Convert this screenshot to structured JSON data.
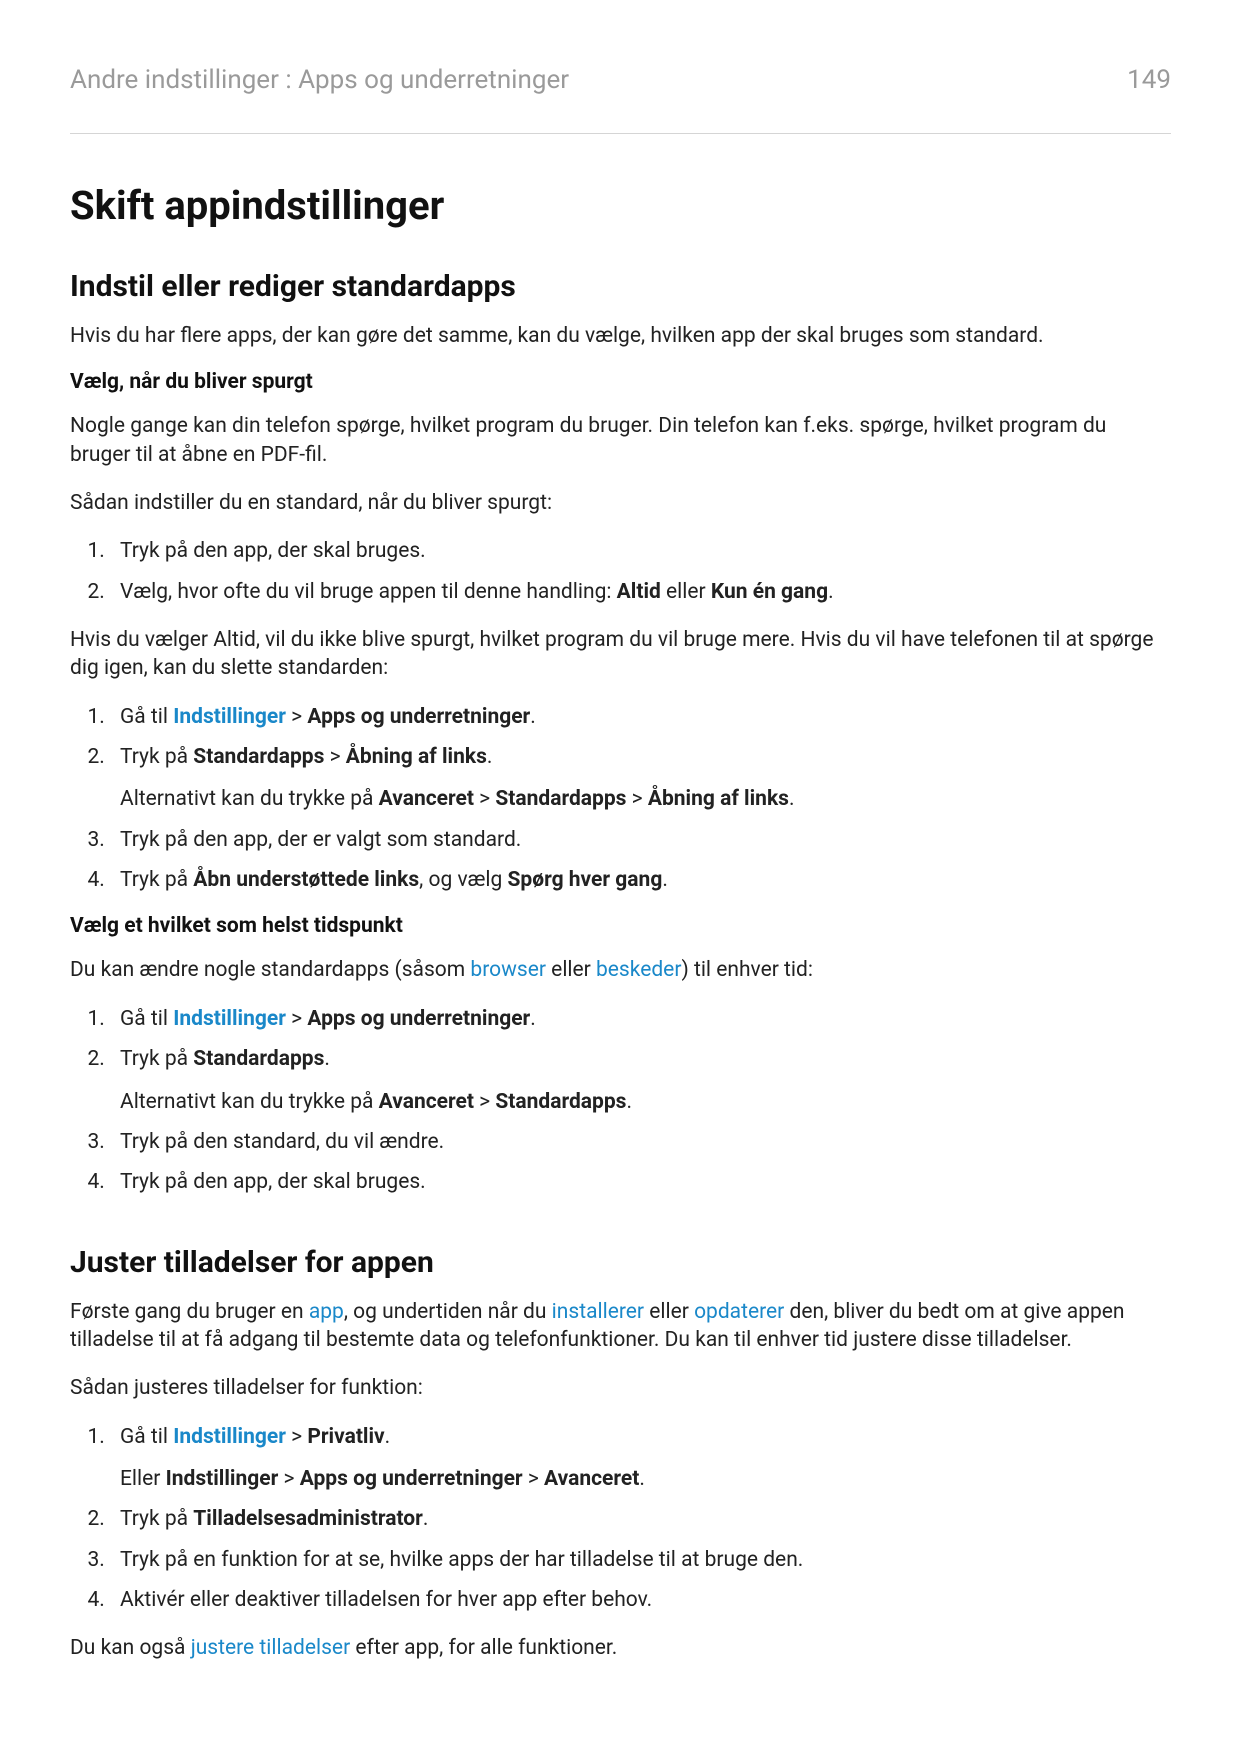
{
  "header": {
    "breadcrumb": "Andre indstillinger : Apps og underretninger",
    "page": "149"
  },
  "title": "Skift appindstillinger",
  "section1": {
    "heading": "Indstil eller rediger standardapps",
    "intro": "Hvis du har flere apps, der kan gøre det samme, kan du vælge, hvilken app der skal bruges som standard.",
    "sub1_heading": "Vælg, når du bliver spurgt",
    "sub1_p1": "Nogle gange kan din telefon spørge, hvilket program du bruger. Din telefon kan f.eks. spørge, hvilket program du bruger til at åbne en PDF-fil.",
    "sub1_p2": "Sådan indstiller du en standard, når du bliver spurgt:",
    "sub1_list": {
      "i1": "Tryk på den app, der skal bruges.",
      "i2_pre": "Vælg, hvor ofte du vil bruge appen til denne handling: ",
      "i2_b1": "Altid",
      "i2_mid": " eller ",
      "i2_b2": "Kun én gang",
      "i2_end": "."
    },
    "sub1_p3": "Hvis du vælger Altid, vil du ikke blive spurgt, hvilket program du vil bruge mere. Hvis du vil have telefonen til at spørge dig igen, kan du slette standarden:",
    "sub1_list2": {
      "i1_pre": "Gå til ",
      "i1_link": "Indstillinger",
      "i1_gt": " > ",
      "i1_b": "Apps og underretninger",
      "i1_end": ".",
      "i2_pre": "Tryk på ",
      "i2_b1": "Standardapps",
      "i2_gt": " > ",
      "i2_b2": "Åbning af links",
      "i2_end": ".",
      "i2_sub_pre": "Alternativt kan du trykke på ",
      "i2_sub_b1": "Avanceret",
      "i2_sub_gt1": " > ",
      "i2_sub_b2": "Standardapps",
      "i2_sub_gt2": " > ",
      "i2_sub_b3": "Åbning af links",
      "i2_sub_end": ".",
      "i3": "Tryk på den app, der er valgt som standard.",
      "i4_pre": "Tryk på ",
      "i4_b1": "Åbn understøttede links",
      "i4_mid": ", og vælg ",
      "i4_b2": "Spørg hver gang",
      "i4_end": "."
    },
    "sub2_heading": "Vælg et hvilket som helst tidspunkt",
    "sub2_p1_pre": "Du kan ændre nogle standardapps (såsom ",
    "sub2_p1_link1": "browser",
    "sub2_p1_mid": " eller ",
    "sub2_p1_link2": "beskeder",
    "sub2_p1_end": ") til enhver tid:",
    "sub2_list": {
      "i1_pre": "Gå til ",
      "i1_link": "Indstillinger",
      "i1_gt": " > ",
      "i1_b": "Apps og underretninger",
      "i1_end": ".",
      "i2_pre": "Tryk på ",
      "i2_b": "Standardapps",
      "i2_end": ".",
      "i2_sub_pre": "Alternativt kan du trykke på ",
      "i2_sub_b1": "Avanceret",
      "i2_sub_gt": " > ",
      "i2_sub_b2": "Standardapps",
      "i2_sub_end": ".",
      "i3": "Tryk på den standard, du vil ændre.",
      "i4": "Tryk på den app, der skal bruges."
    }
  },
  "section2": {
    "heading": "Juster tilladelser for appen",
    "p1_pre": "Første gang du bruger en ",
    "p1_link1": "app",
    "p1_mid1": ", og undertiden når du ",
    "p1_link2": "installerer",
    "p1_mid2": " eller ",
    "p1_link3": "opdaterer",
    "p1_end": " den, bliver du bedt om at give appen tilladelse til at få adgang til bestemte data og telefonfunktioner. Du kan til enhver tid justere disse tilladelser.",
    "p2": "Sådan justeres tilladelser for funktion:",
    "list": {
      "i1_pre": "Gå til ",
      "i1_link": "Indstillinger",
      "i1_gt": " > ",
      "i1_b": "Privatliv",
      "i1_end": ".",
      "i1_sub_pre": "Eller ",
      "i1_sub_b1": "Indstillinger",
      "i1_sub_gt1": " > ",
      "i1_sub_b2": "Apps og underretninger",
      "i1_sub_gt2": " > ",
      "i1_sub_b3": "Avanceret",
      "i1_sub_end": ".",
      "i2_pre": "Tryk på ",
      "i2_b": "Tilladelsesadministrator",
      "i2_end": ".",
      "i3": "Tryk på en funktion for at se, hvilke apps der har tilladelse til at bruge den.",
      "i4": "Aktivér eller deaktiver tilladelsen for hver app efter behov."
    },
    "p3_pre": "Du kan også ",
    "p3_link": "justere tilladelser",
    "p3_end": " efter app, for alle funktioner."
  }
}
